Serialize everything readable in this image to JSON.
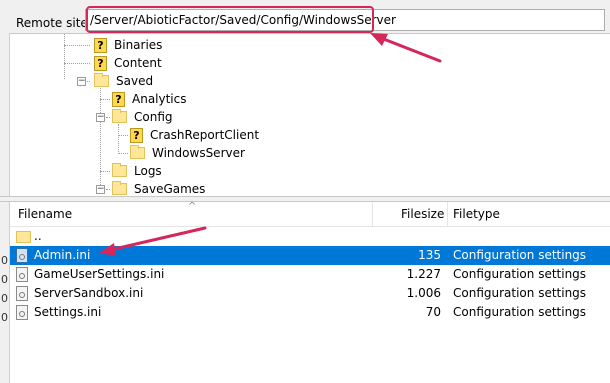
{
  "site_bar": {
    "label": "Remote site:",
    "path": "/Server/AbioticFactor/Saved/Config/WindowsServer"
  },
  "tree": {
    "nodes": [
      {
        "label": "Binaries",
        "icon": "question-folder-icon"
      },
      {
        "label": "Content",
        "icon": "question-folder-icon"
      },
      {
        "label": "Saved",
        "icon": "folder-icon"
      },
      {
        "label": "Analytics",
        "icon": "question-folder-icon"
      },
      {
        "label": "Config",
        "icon": "folder-icon"
      },
      {
        "label": "CrashReportClient",
        "icon": "question-folder-icon"
      },
      {
        "label": "WindowsServer",
        "icon": "folder-icon"
      },
      {
        "label": "Logs",
        "icon": "folder-icon"
      },
      {
        "label": "SaveGames",
        "icon": "folder-icon"
      }
    ]
  },
  "file_list": {
    "columns": {
      "filename": "Filename",
      "filesize": "Filesize",
      "filetype": "Filetype"
    },
    "rows": [
      {
        "name": "..",
        "size": "",
        "type": ""
      },
      {
        "name": "Admin.ini",
        "size": "135",
        "type": "Configuration settings",
        "selected": true
      },
      {
        "name": "GameUserSettings.ini",
        "size": "1.227",
        "type": "Configuration settings"
      },
      {
        "name": "ServerSandbox.ini",
        "size": "1.006",
        "type": "Configuration settings"
      },
      {
        "name": "Settings.ini",
        "size": "70",
        "type": "Configuration settings"
      }
    ]
  },
  "edge_digits": [
    "0",
    "0",
    "0",
    "0"
  ],
  "colors": {
    "selection": "#0078d7",
    "annotation": "#d6275a"
  }
}
